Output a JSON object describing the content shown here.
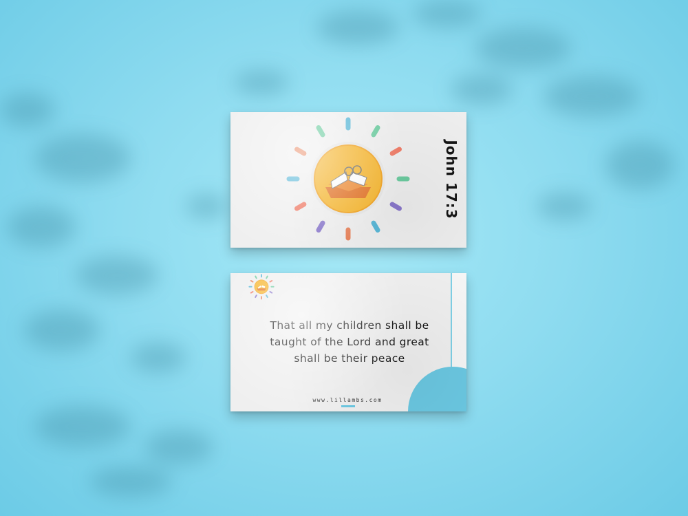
{
  "backdrop": {
    "color": "#8fdcf0",
    "shadow_color": "#4f9bb0"
  },
  "card_front": {
    "verse_reference": "John 17:3",
    "icon": "sun-book-glasses-icon",
    "ray_colors": [
      "#5ab8d8",
      "#6ccca0",
      "#f07a65",
      "#6ccca0",
      "#8a78cc",
      "#5ab8d8",
      "#e8825a",
      "#8a78cc",
      "#f07a65",
      "#5ab8d8",
      "#e8825a",
      "#6ccca0"
    ]
  },
  "card_back": {
    "verse_text": "That all my children shall be taught of the Lord and great shall be their peace",
    "website": "www.lillambs.com",
    "accent_color": "#6bc8e2",
    "icon": "sun-book-glasses-icon"
  }
}
